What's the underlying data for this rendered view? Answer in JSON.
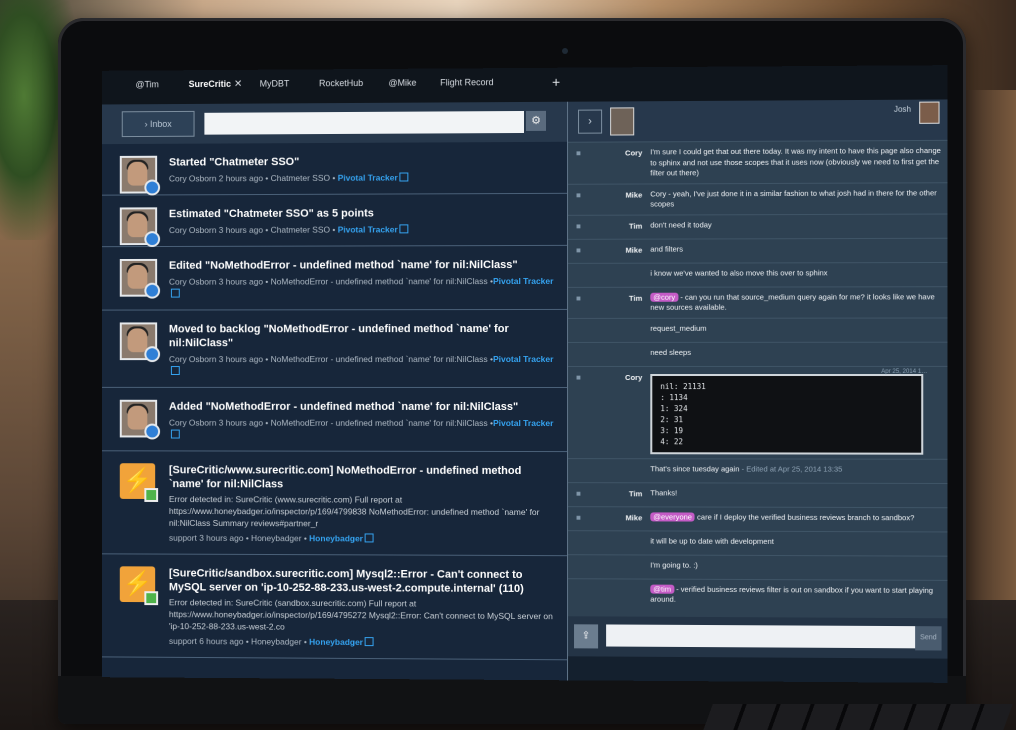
{
  "tabs": [
    {
      "label": "@Tim",
      "active": false
    },
    {
      "label": "SureCritic",
      "active": true
    },
    {
      "label": "MyDBT",
      "active": false
    },
    {
      "label": "RocketHub",
      "active": false
    },
    {
      "label": "@Mike",
      "active": false
    },
    {
      "label": "Flight Record",
      "active": false
    }
  ],
  "tab_close": "✕",
  "tab_add": "+",
  "toolbar": {
    "inbox_label": "› Inbox",
    "search_placeholder": "",
    "gear": "⚙"
  },
  "feed": [
    {
      "type": "pivotal",
      "title": "Started \"Chatmeter SSO\"",
      "meta": "Cory Osborn 2 hours ago • Chatmeter SSO • ",
      "link": "Pivotal Tracker"
    },
    {
      "type": "pivotal",
      "title": "Estimated \"Chatmeter SSO\" as 5 points",
      "meta": "Cory Osborn 3 hours ago • Chatmeter SSO • ",
      "link": "Pivotal Tracker"
    },
    {
      "type": "pivotal",
      "title": "Edited \"NoMethodError - undefined method `name' for nil:NilClass\"",
      "meta": "Cory Osborn 3 hours ago • NoMethodError - undefined method `name' for nil:NilClass •",
      "link": "Pivotal Tracker"
    },
    {
      "type": "pivotal",
      "title": "Moved to backlog \"NoMethodError - undefined method `name' for nil:NilClass\"",
      "meta": "Cory Osborn 3 hours ago • NoMethodError - undefined method `name' for nil:NilClass •",
      "link": "Pivotal Tracker"
    },
    {
      "type": "pivotal",
      "title": "Added \"NoMethodError - undefined method `name' for nil:NilClass\"",
      "meta": "Cory Osborn 3 hours ago • NoMethodError - undefined method `name' for nil:NilClass •",
      "link": "Pivotal Tracker"
    },
    {
      "type": "honeybadger",
      "title": "[SureCritic/www.surecritic.com] NoMethodError - undefined method `name' for nil:NilClass",
      "detail": "Error detected in: SureCritic (www.surecritic.com) Full report at https://www.honeybadger.io/inspector/p/169/4799838 NoMethodError: undefined method `name' for nil:NilClass Summary reviews#partner_r",
      "meta": "support 3 hours ago • Honeybadger • ",
      "link": "Honeybadger"
    },
    {
      "type": "honeybadger",
      "title": "[SureCritic/sandbox.surecritic.com] Mysql2::Error - Can't connect to MySQL server on 'ip-10-252-88-233.us-west-2.compute.internal' (110)",
      "detail": "Error detected in: SureCritic (sandbox.surecritic.com) Full report at https://www.honeybadger.io/inspector/p/169/4795272 Mysql2::Error: Can't connect to MySQL server on 'ip-10-252-88-233.us-west-2.co",
      "meta": "support 6 hours ago • Honeybadger • ",
      "link": "Honeybadger"
    }
  ],
  "chat_header": {
    "chevron": "›",
    "user_name": "Josh"
  },
  "chat": [
    {
      "author": "Cory",
      "text": "I'm sure I could get that out there today.  It was my intent to have this page also change to sphinx and not use those scopes that it uses now (obviously we need to first get the filter out there)"
    },
    {
      "author": "Mike",
      "text": "Cory - yeah, I've just done it in a similar fashion to what josh had in there for the other scopes"
    },
    {
      "author": "Tim",
      "text": "don't need it today"
    },
    {
      "author": "Mike",
      "text": "and filters"
    },
    {
      "author": "",
      "text": "i know we've wanted to also move this over to sphinx"
    },
    {
      "author": "Tim",
      "mention": "@cory",
      "text": " - can you run that source_medium query again for me? it looks like we have new sources available."
    },
    {
      "author": "",
      "text": "request_medium"
    },
    {
      "author": "",
      "text": "need sleeps"
    },
    {
      "author": "Cory",
      "code": [
        "nil: 21131",
        "  : 1134",
        "1: 324",
        "2: 31",
        "3: 19",
        "4: 22"
      ],
      "stamp": "Apr 25, 2014 1…"
    },
    {
      "author": "",
      "text": "That's since tuesday again",
      "edited": " - Edited at Apr 25, 2014 13:35"
    },
    {
      "author": "Tim",
      "text": "Thanks!"
    },
    {
      "author": "Mike",
      "mention": "@everyone",
      "text": " care if I deploy the verified business reviews branch to sandbox?"
    },
    {
      "author": "",
      "text": "it will be up to date with development"
    },
    {
      "author": "",
      "text": "I'm going to. :)"
    },
    {
      "author": "",
      "mention": "@tim",
      "text": " - verified business reviews filter is out on sandbox if you want to start playing around."
    }
  ],
  "chat_input": {
    "placeholder": "",
    "send_label": "Send",
    "upload_icon": "⇪"
  }
}
